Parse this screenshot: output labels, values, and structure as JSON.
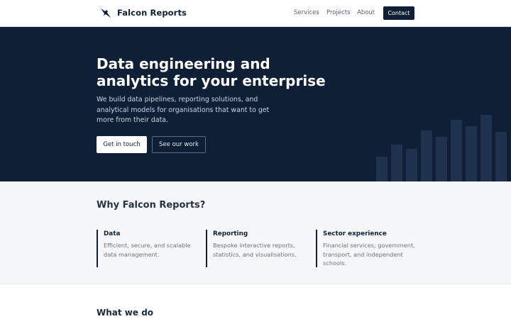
{
  "header": {
    "brand": "Falcon Reports",
    "logo_icon": "falcon-icon",
    "nav": {
      "services": "Services",
      "projects": "Projects",
      "about": "About"
    },
    "contact_label": "Contact"
  },
  "hero": {
    "title": "Data engineering and analytics for your enterprise",
    "description": "We build data pipelines, reporting solutions, and analytical models for organisations that want to get more from their data.",
    "primary_button": "Get in touch",
    "secondary_button": "See our work",
    "decoration_bar_levels": [
      0.16,
      0.24,
      0.21,
      0.33,
      0.29,
      0.4,
      0.36,
      0.43,
      0.32
    ]
  },
  "why": {
    "title": "Why Falcon Reports?",
    "features": [
      {
        "title": "Data",
        "description": "Efficient, secure, and scalable data management."
      },
      {
        "title": "Reporting",
        "description": "Bespoke interactive reports, statistics, and visualisations."
      },
      {
        "title": "Sector experience",
        "description": "Financial services, government, transport, and independent schools."
      }
    ]
  },
  "what": {
    "title": "What we do"
  },
  "colors": {
    "navy": "#0f1f36",
    "bar": "#1f324d",
    "section_bg": "#f6f7f9"
  }
}
